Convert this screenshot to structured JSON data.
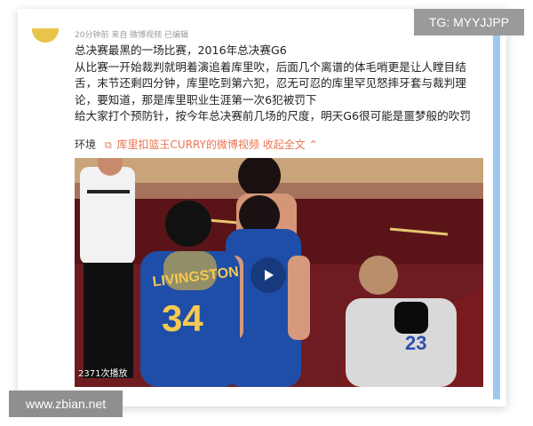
{
  "post": {
    "meta": "20分钟前 来自 微博视频 已编辑",
    "lines": [
      "总决赛最黑的一场比赛，2016年总决赛G6",
      "从比赛一开始裁判就明着演追着库里吹，后面几个离谱的体毛哨更是让人瞠目结",
      "舌，末节还剩四分钟，库里吃到第六犯，忍无可忍的库里罕见怒摔牙套与裁判理",
      "论，要知道，那是库里职业生涯第一次6犯被罚下",
      "给大家打个预防针，按今年总决赛前几场的尺度，明天G6很可能是噩梦般的吹罚"
    ],
    "last_line": "环境",
    "link_text": "库里扣篮王CURRY的微博视频",
    "expand_text": "收起全文",
    "expand_icon": "chevron-up-icon"
  },
  "video": {
    "play_count": "2371次播放",
    "player_name": "LIVINGSTON",
    "player_number": "34",
    "referee_number": "23"
  },
  "overlays": {
    "tg": "TG: MYYJJPP",
    "watermark": "www.zbian.net"
  },
  "colors": {
    "link": "#eb7350",
    "accent": "#9ec8ef",
    "court": "#5a1418",
    "jersey": "#1f4ea8"
  }
}
